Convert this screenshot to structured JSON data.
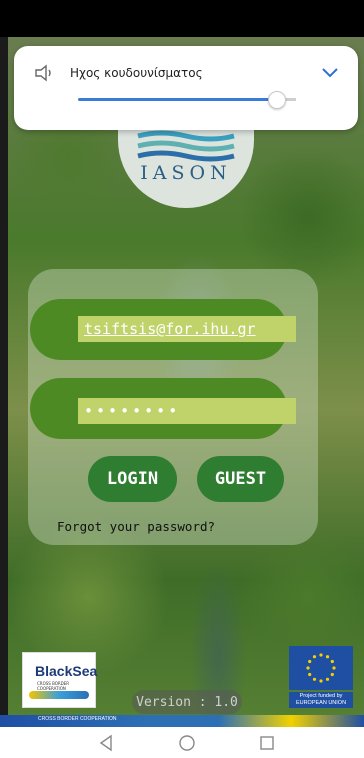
{
  "volume_panel": {
    "label": "Ηχος κουδουνίσματος",
    "level_percent": 92,
    "speaker_icon": "speaker-icon",
    "expand_icon": "chevron-down-icon"
  },
  "logo": {
    "text": "IASON"
  },
  "login": {
    "email_value": "tsiftsis@for.ihu.gr",
    "password_value": "••••••••",
    "login_label": "LOGIN",
    "guest_label": "GUEST",
    "forgot_label": "Forgot your password?"
  },
  "footer": {
    "blacksea_text": "BlackSea",
    "blacksea_sub": "CROSS BORDER COOPERATION",
    "eu_caption": "Project funded by EUROPEAN UNION",
    "version": "Version : 1.0",
    "strip_text": "CROSS BORDER COOPERATION"
  },
  "colors": {
    "accent_green": "#2f7d31",
    "field_green": "#4d8a24",
    "input_fill": "#bfd36a",
    "slider_blue": "#3a7bd5"
  },
  "nav": {
    "back_icon": "back-triangle-icon",
    "home_icon": "home-circle-icon",
    "recents_icon": "recents-square-icon"
  }
}
